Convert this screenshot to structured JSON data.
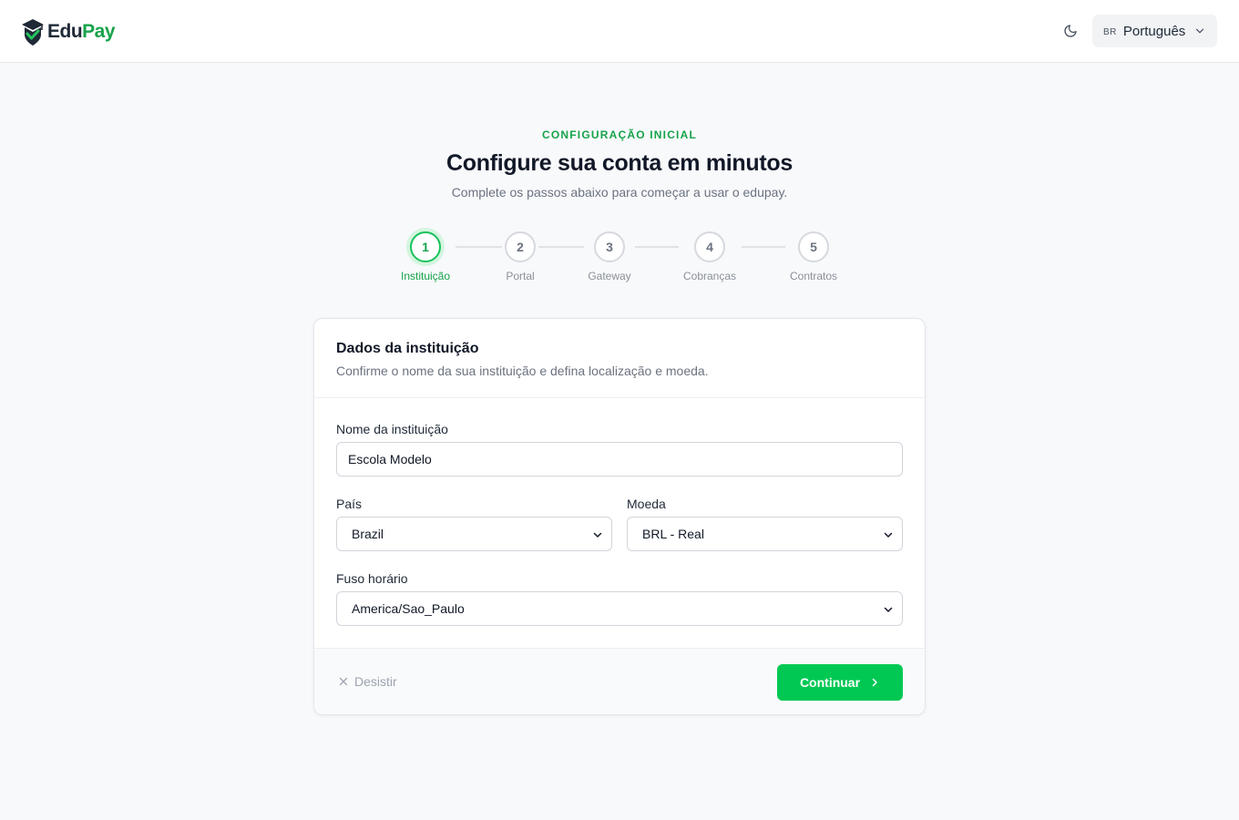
{
  "header": {
    "logo": {
      "part1": "Edu",
      "part2": "Pay",
      "icon": "graduation-cap-shield-icon"
    },
    "theme_toggle": {
      "icon": "moon-icon"
    },
    "language": {
      "code": "BR",
      "label": "Português",
      "icon": "chevron-down-icon"
    }
  },
  "intro": {
    "eyebrow": "CONFIGURAÇÃO INICIAL",
    "title": "Configure sua conta em minutos",
    "subtitle": "Complete os passos abaixo para começar a usar o edupay."
  },
  "steps": [
    {
      "number": "1",
      "label": "Instituição",
      "active": true
    },
    {
      "number": "2",
      "label": "Portal",
      "active": false
    },
    {
      "number": "3",
      "label": "Gateway",
      "active": false
    },
    {
      "number": "4",
      "label": "Cobranças",
      "active": false
    },
    {
      "number": "5",
      "label": "Contratos",
      "active": false
    }
  ],
  "card": {
    "title": "Dados da instituição",
    "description": "Confirme o nome da sua instituição e defina localização e moeda.",
    "fields": {
      "name": {
        "label": "Nome da instituição",
        "value": "Escola Modelo"
      },
      "country": {
        "label": "País",
        "value": "Brazil"
      },
      "currency": {
        "label": "Moeda",
        "value": "BRL - Real"
      },
      "timezone": {
        "label": "Fuso horário",
        "value": "America/Sao_Paulo"
      }
    },
    "footer": {
      "cancel_label": "Desistir",
      "continue_label": "Continuar"
    }
  },
  "colors": {
    "accent": "#16a34a",
    "button": "#00c853",
    "background": "#f8f9fb"
  }
}
